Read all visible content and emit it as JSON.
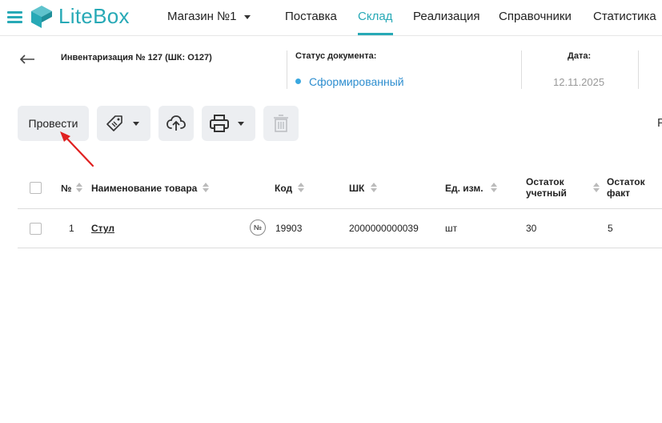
{
  "app": {
    "logo_text": "LiteBox",
    "brand_color": "#27a9b6",
    "store_selector": "Магазин №1"
  },
  "nav": {
    "items": [
      {
        "label": "Поставка"
      },
      {
        "label": "Склад",
        "active": true
      },
      {
        "label": "Реализация"
      },
      {
        "label": "Справочники"
      },
      {
        "label": "Статистика"
      }
    ]
  },
  "document": {
    "title": "Инвентаризация № 127 (ШК: О127)",
    "status_label": "Статус документа:",
    "status_value": "Сформированный",
    "status_color": "#3aa8e0",
    "date_label": "Дата:",
    "date_value": "12.11.2025"
  },
  "toolbar": {
    "post_label": "Провести",
    "tag_icon": "price-tag-icon",
    "upload_icon": "cloud-upload-icon",
    "print_icon": "printer-icon",
    "delete_icon": "trash-icon",
    "cut_text": "Р"
  },
  "table": {
    "headers": {
      "num": "№",
      "name": "Наименование товара",
      "code": "Код",
      "barcode": "ШК",
      "unit": "Ед. изм.",
      "stock_book_1": "Остаток",
      "stock_book_2": "учетный",
      "stock_fact_1": "Остаток",
      "stock_fact_2": "факт"
    },
    "rows": [
      {
        "num": "1",
        "name": "Стул",
        "code_icon": "№",
        "code": "19903",
        "barcode": "2000000000039",
        "unit": "шт",
        "stock_book": "30",
        "stock_fact": "5"
      }
    ]
  }
}
